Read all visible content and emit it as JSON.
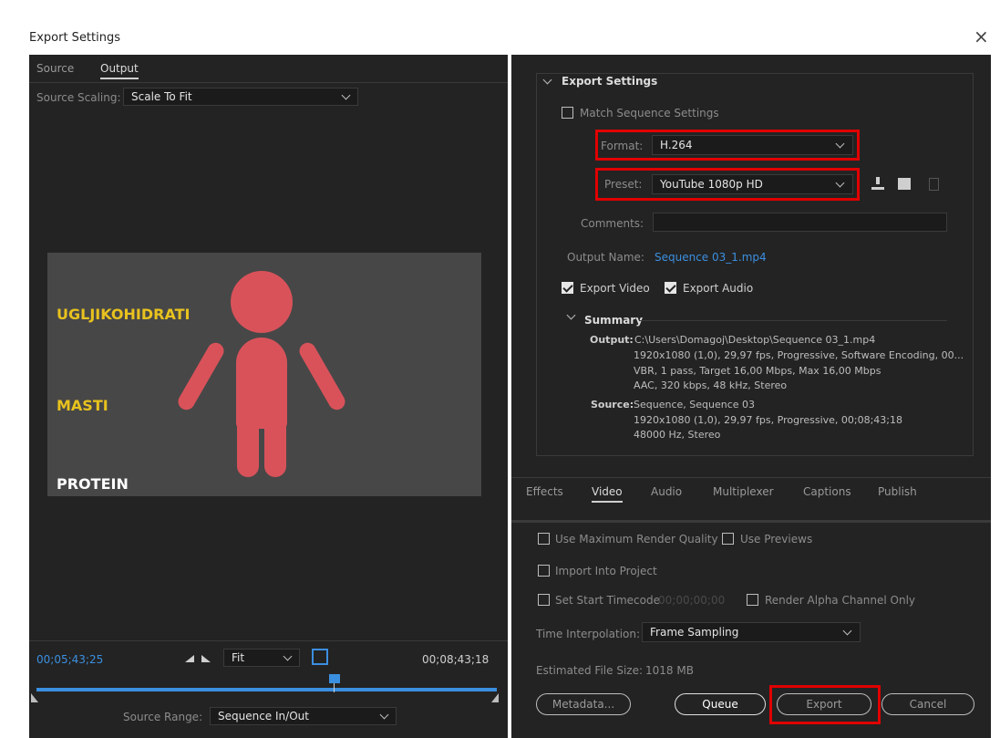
{
  "window": {
    "title": "Export Settings",
    "close": "×"
  },
  "left": {
    "tabs": [
      "Source",
      "Output"
    ],
    "source_scaling_label": "Source Scaling:",
    "source_scaling_value": "Scale To Fit",
    "preview": {
      "labels": [
        "UGLJIKOHIDRATI",
        "MASTI",
        "PROTEIN"
      ],
      "label_colors": [
        "#e8c21e",
        "#e8c21e",
        "#ffffff"
      ],
      "figure_color": "#d9525a"
    },
    "timecode_current": "00;05;43;25",
    "timecode_end": "00;08;43;18",
    "fit_value": "Fit",
    "source_range_label": "Source Range:",
    "source_range_value": "Sequence In/Out"
  },
  "right": {
    "export_settings_heading": "Export Settings",
    "match_sequence": "Match Sequence Settings",
    "format_label": "Format:",
    "format_value": "H.264",
    "preset_label": "Preset:",
    "preset_value": "YouTube 1080p HD",
    "comments_label": "Comments:",
    "comments_value": "",
    "output_name_label": "Output Name:",
    "output_name_value": "Sequence 03_1.mp4",
    "export_video": "Export Video",
    "export_audio": "Export Audio",
    "summary_heading": "Summary",
    "summary_output_label": "Output:",
    "summary_output_lines": [
      "C:\\Users\\Domagoj\\Desktop\\Sequence 03_1.mp4",
      "1920x1080 (1,0), 29,97 fps, Progressive, Software Encoding, 00...",
      "VBR, 1 pass, Target 16,00 Mbps, Max 16,00 Mbps",
      "AAC, 320 kbps, 48 kHz, Stereo"
    ],
    "summary_source_label": "Source:",
    "summary_source_lines": [
      "Sequence, Sequence 03",
      "1920x1080 (1,0), 29,97 fps, Progressive, 00;08;43;18",
      "48000 Hz, Stereo"
    ],
    "tabs": [
      "Effects",
      "Video",
      "Audio",
      "Multiplexer",
      "Captions",
      "Publish"
    ],
    "use_max_render": "Use Maximum Render Quality",
    "use_previews": "Use Previews",
    "import_into_project": "Import Into Project",
    "set_start_timecode": "Set Start Timecode",
    "start_timecode_value": "00;00;00;00",
    "render_alpha": "Render Alpha Channel Only",
    "time_interp_label": "Time Interpolation:",
    "time_interp_value": "Frame Sampling",
    "est_size_label": "Estimated File Size:",
    "est_size_value": "1018 MB",
    "buttons": {
      "metadata": "Metadata...",
      "queue": "Queue",
      "export": "Export",
      "cancel": "Cancel"
    }
  }
}
